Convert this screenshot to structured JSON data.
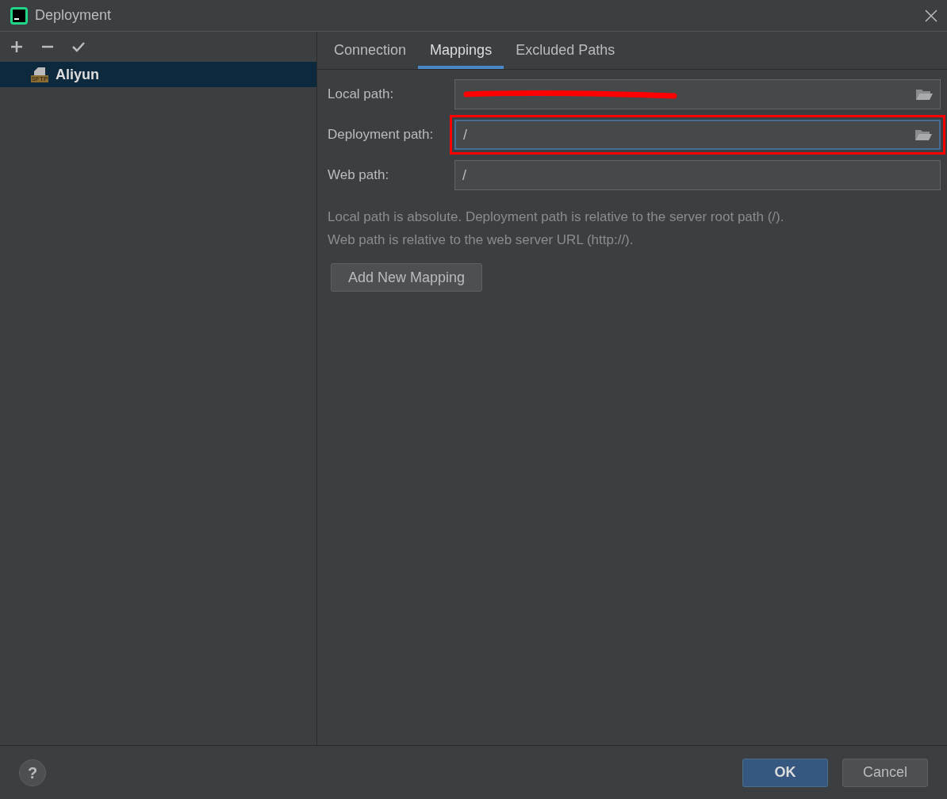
{
  "window": {
    "title": "Deployment"
  },
  "toolbar": [
    {
      "kind": "add"
    },
    {
      "kind": "remove"
    },
    {
      "kind": "check"
    }
  ],
  "servers": [
    {
      "name": "Aliyun",
      "type": "SFTP",
      "selected": true
    }
  ],
  "tabs": [
    {
      "label": "Connection",
      "selected": false
    },
    {
      "label": "Mappings",
      "selected": true
    },
    {
      "label": "Excluded Paths",
      "selected": false
    }
  ],
  "fields": [
    {
      "label": "Local path:",
      "redacted": true,
      "browse": true,
      "focused": false,
      "highlighted": false
    },
    {
      "label": "Deployment path:",
      "value": "/",
      "redacted": false,
      "browse": true,
      "focused": true,
      "highlighted": true
    },
    {
      "label": "Web path:",
      "value": "/",
      "redacted": false,
      "browse": false,
      "focused": false,
      "highlighted": false
    }
  ],
  "hint": [
    "Local path is absolute. Deployment path is relative to the server root path (/).",
    "Web path is relative to the web server URL (http://)."
  ],
  "add_button": "Add New Mapping",
  "footer": {
    "help": "?",
    "ok": "OK",
    "cancel": "Cancel"
  }
}
